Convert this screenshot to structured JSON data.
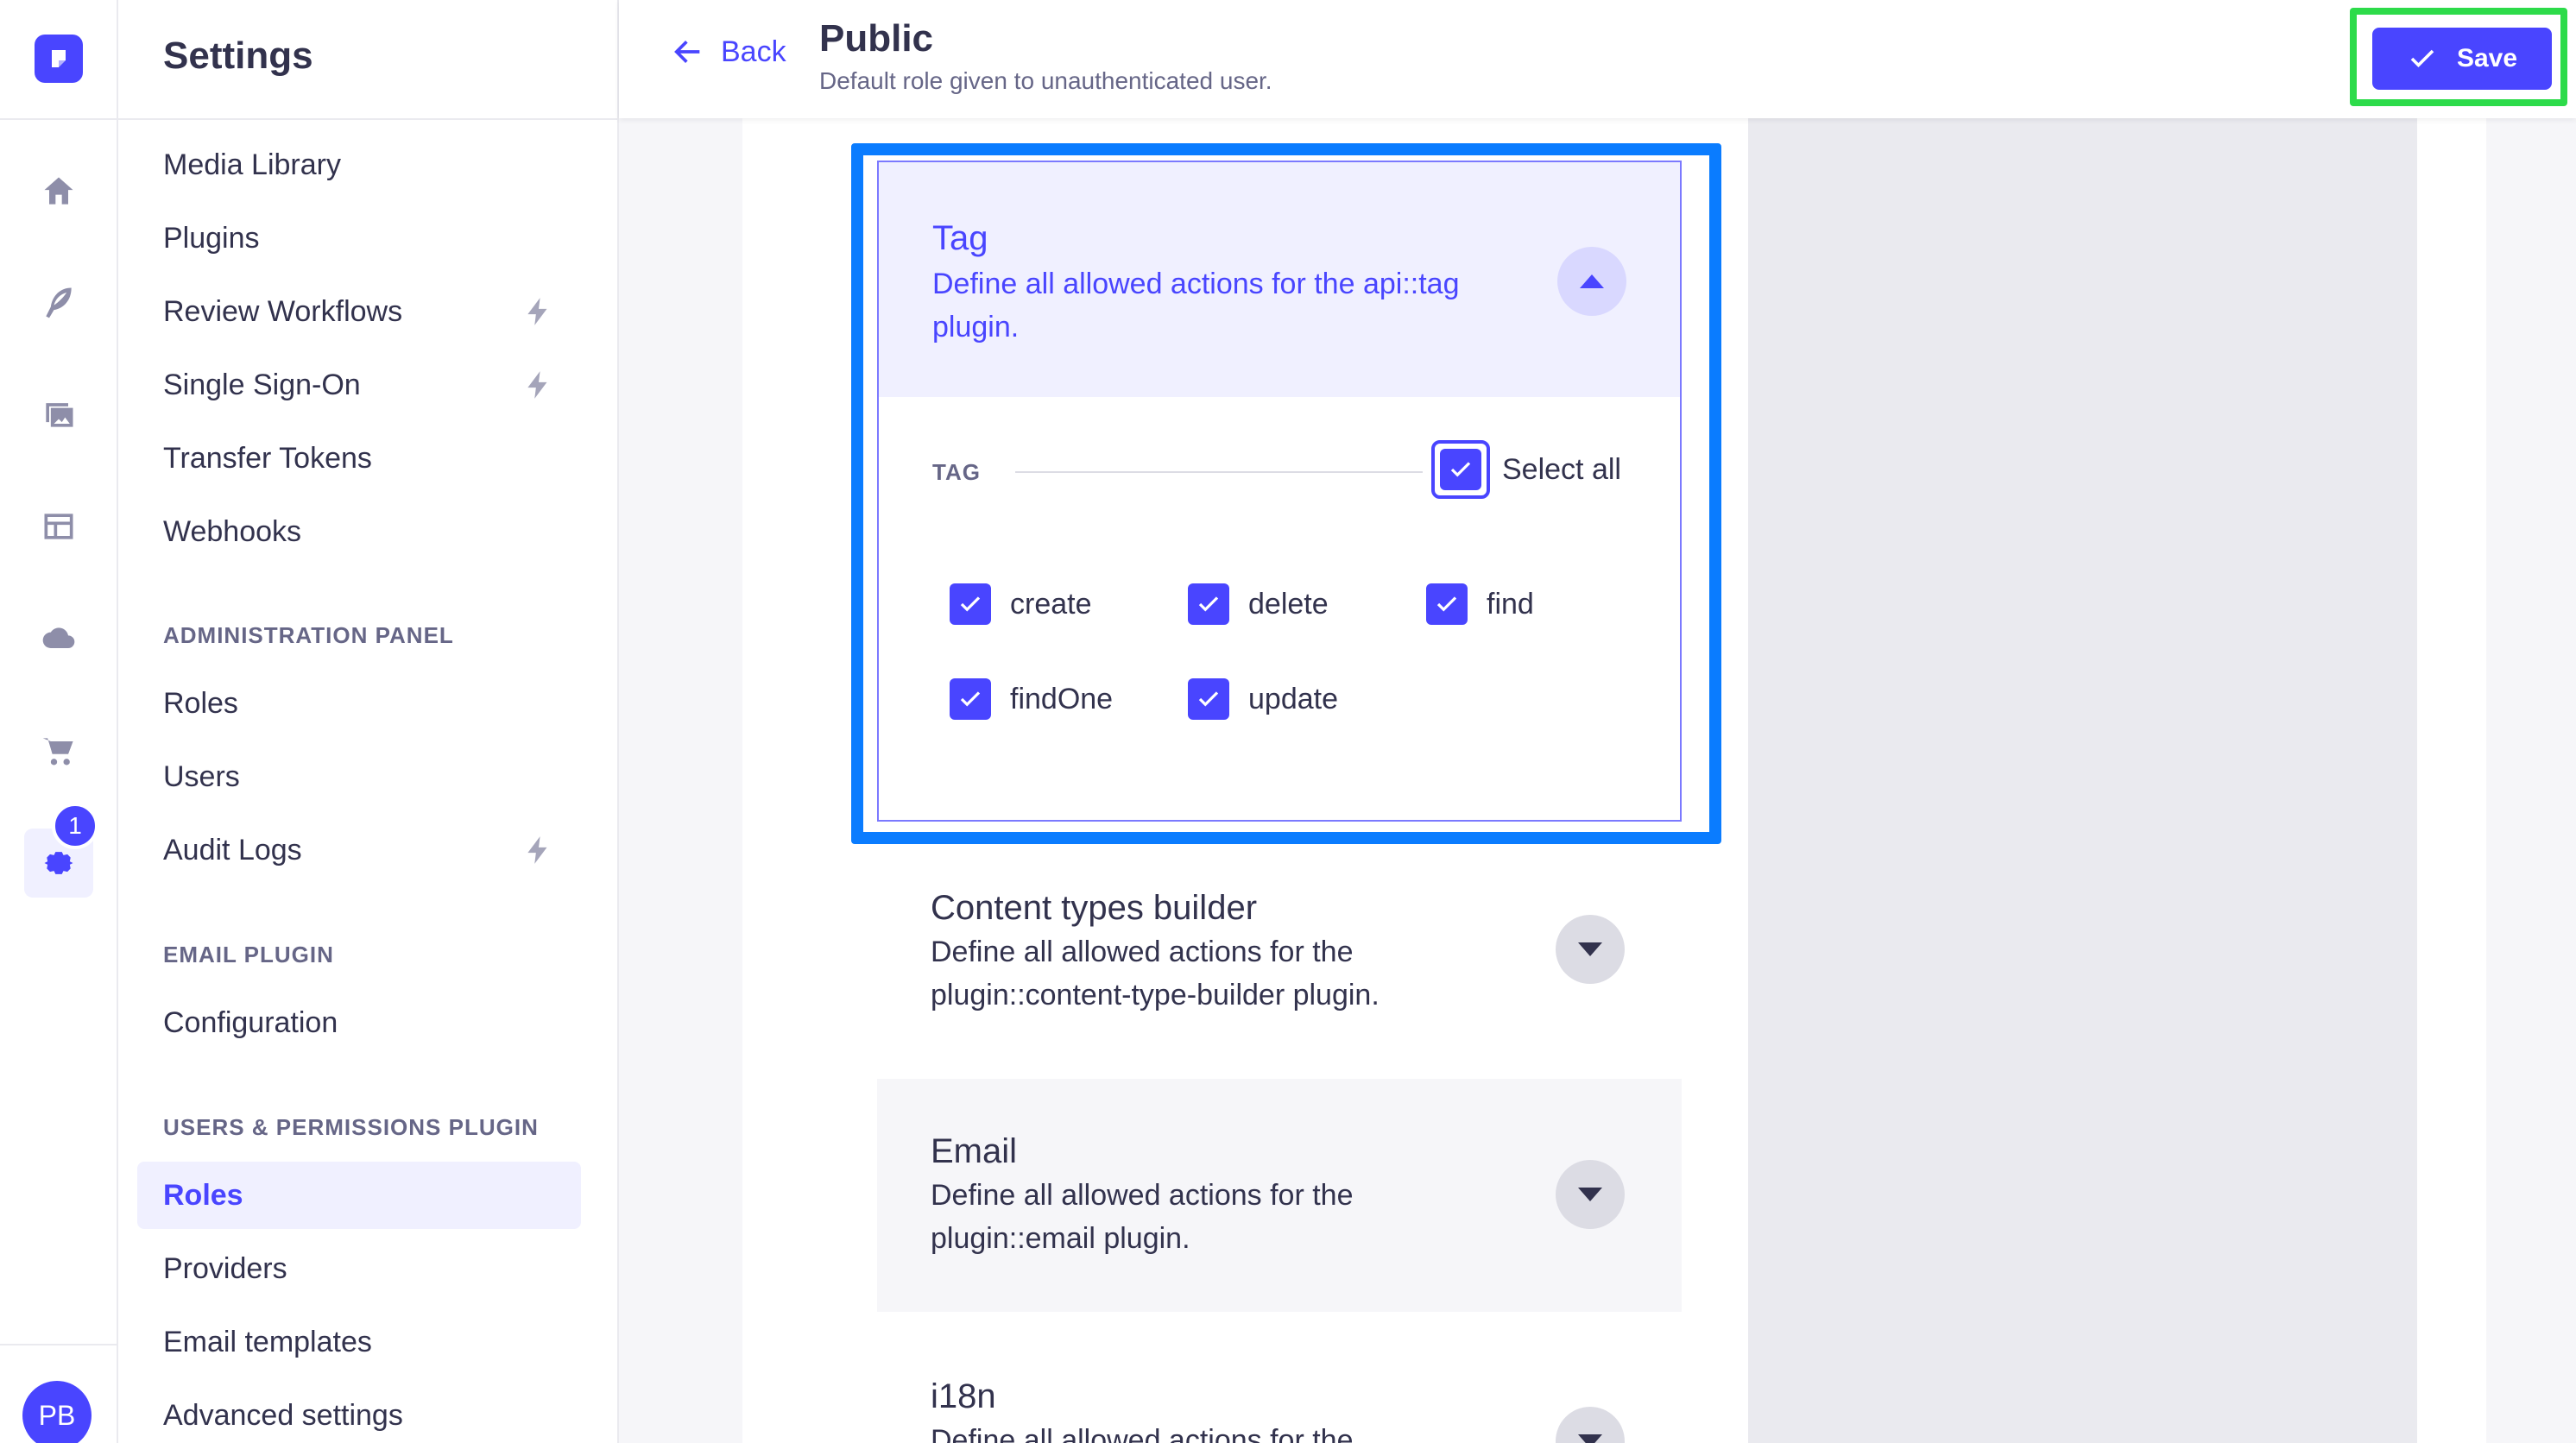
{
  "rail": {
    "icons": [
      "logo-icon",
      "home-icon",
      "feather-icon",
      "media-icon",
      "layout-icon",
      "cloud-icon",
      "cart-icon",
      "settings-icon"
    ],
    "badge_count": "1",
    "avatar_initials": "PB"
  },
  "sidebar": {
    "title": "Settings",
    "items_general": [
      {
        "label": "Media Library",
        "locked": false
      },
      {
        "label": "Plugins",
        "locked": false
      },
      {
        "label": "Review Workflows",
        "locked": true
      },
      {
        "label": "Single Sign-On",
        "locked": true
      },
      {
        "label": "Transfer Tokens",
        "locked": false
      },
      {
        "label": "Webhooks",
        "locked": false
      }
    ],
    "section_admin": "ADMINISTRATION PANEL",
    "items_admin": [
      {
        "label": "Roles",
        "locked": false
      },
      {
        "label": "Users",
        "locked": false
      },
      {
        "label": "Audit Logs",
        "locked": true
      }
    ],
    "section_email": "EMAIL PLUGIN",
    "items_email": [
      {
        "label": "Configuration"
      }
    ],
    "section_users": "USERS & PERMISSIONS PLUGIN",
    "items_users": [
      {
        "label": "Roles",
        "active": true
      },
      {
        "label": "Providers"
      },
      {
        "label": "Email templates"
      },
      {
        "label": "Advanced settings"
      }
    ]
  },
  "header": {
    "back_label": "Back",
    "title": "Public",
    "subtitle": "Default role given to unauthenticated user.",
    "save_label": "Save"
  },
  "permissions": {
    "tag": {
      "title": "Tag",
      "description": "Define all allowed actions for the api::tag plugin.",
      "group_label": "TAG",
      "select_all_label": "Select all",
      "select_all_checked": true,
      "actions": [
        {
          "label": "create",
          "checked": true
        },
        {
          "label": "delete",
          "checked": true
        },
        {
          "label": "find",
          "checked": true
        },
        {
          "label": "findOne",
          "checked": true
        },
        {
          "label": "update",
          "checked": true
        }
      ]
    },
    "content_types_builder": {
      "title": "Content types builder",
      "description": "Define all allowed actions for the plugin::content-type-builder plugin."
    },
    "email": {
      "title": "Email",
      "description": "Define all allowed actions for the plugin::email plugin."
    },
    "i18n": {
      "title": "i18n",
      "description": "Define all allowed actions for the"
    }
  },
  "colors": {
    "primary": "#4945ff",
    "highlight_blue": "#0a7cff",
    "highlight_green": "#2ddb4a"
  }
}
